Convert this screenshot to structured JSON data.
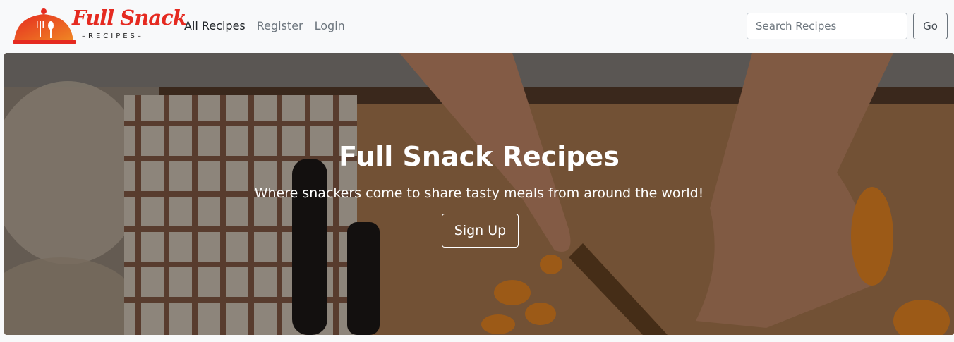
{
  "brand": {
    "title": "Full Snack",
    "subtitle": "–RECIPES–",
    "accent_color": "#e52a20",
    "icon": "cloche-fork-spoon-icon"
  },
  "nav": {
    "links": [
      {
        "label": "All Recipes",
        "active": true
      },
      {
        "label": "Register",
        "active": false
      },
      {
        "label": "Login",
        "active": false
      }
    ]
  },
  "search": {
    "placeholder": "Search Recipes",
    "value": "",
    "button_label": "Go"
  },
  "hero": {
    "title": "Full Snack Recipes",
    "subtitle": "Where snackers come to share tasty meals from around the world!",
    "cta_label": "Sign Up",
    "background": "kitchen-cutting-board-photo"
  }
}
